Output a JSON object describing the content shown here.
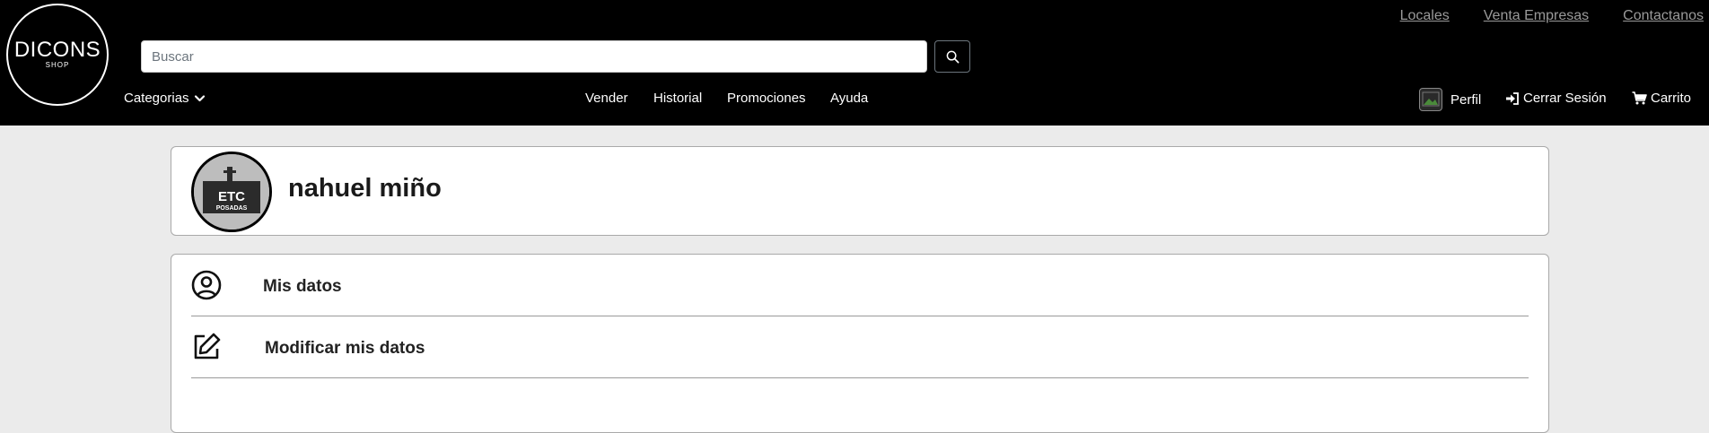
{
  "logo": {
    "main": "DICONS",
    "sub": "SHOP"
  },
  "top_links": [
    "Locales",
    "Venta Empresas",
    "Contactanos"
  ],
  "search": {
    "placeholder": "Buscar",
    "value": ""
  },
  "nav": {
    "categories": "Categorias",
    "center": [
      "Vender",
      "Historial",
      "Promociones",
      "Ayuda"
    ],
    "profile": "Perfil",
    "logout": "Cerrar Sesión",
    "cart": "Carrito"
  },
  "profile": {
    "name": "nahuel miño",
    "avatar_text": {
      "line1": "ETC",
      "line2": "POSADAS"
    }
  },
  "menu": [
    {
      "label": "Mis datos",
      "icon": "user-circle-icon"
    },
    {
      "label": "Modificar mis datos",
      "icon": "edit-icon"
    }
  ],
  "colors": {
    "header_bg": "#000000",
    "page_bg": "#ebebeb",
    "link_muted": "#9a9a9a"
  }
}
